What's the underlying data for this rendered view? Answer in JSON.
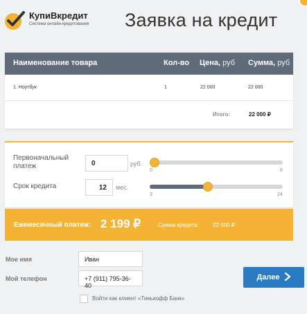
{
  "brand": {
    "name": "КупиВкредит",
    "tagline": "Система онлайн-кредитования",
    "colors": {
      "accent": "#f5b335",
      "header": "#5f6b78",
      "button": "#2b7bc3"
    }
  },
  "page": {
    "title": "Заявка на кредит"
  },
  "table": {
    "headers": {
      "product": "Наименование товара",
      "qty": "Кол-во",
      "price": "Цена,",
      "price_unit": "руб",
      "sum": "Сумма,",
      "sum_unit": "руб"
    },
    "rows": [
      {
        "name": "1. Ноутбук",
        "qty": "1",
        "price": "22 000",
        "sum": "22 000"
      }
    ],
    "total_label": "Итого:",
    "total_value": "22 000 ₽"
  },
  "calculator": {
    "down_payment": {
      "label": "Первоначальный платеж",
      "value": "0",
      "unit": "руб.",
      "min": "0",
      "max": "0",
      "level": 0
    },
    "term": {
      "label": "Срок кредита",
      "value": "12",
      "unit": "мес.",
      "min": "3",
      "max": "24",
      "level": 0.43
    }
  },
  "payment": {
    "monthly_label": "Ежемесячный платеж:",
    "monthly_value": "2 199 ₽",
    "sum_label": "Сумма кредита:",
    "sum_value": "22 000 ₽"
  },
  "form": {
    "name_label": "Мое имя",
    "name_value": "Иван",
    "phone_label": "Мой телефон",
    "phone_value": "+7 (911) 795-36-40",
    "next_label": "Далее",
    "tinkoff_label": "Войти как клиент «Тинькофф Банк»"
  }
}
